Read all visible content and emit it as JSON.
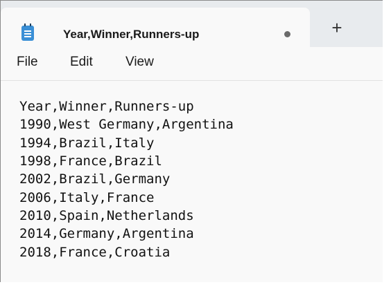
{
  "tab": {
    "title": "Year,Winner,Runners-up",
    "new_tab_label": "+"
  },
  "icons": {
    "app": "notepad-icon",
    "unsaved": "unsaved-dot-icon",
    "new_tab": "plus-icon"
  },
  "menu": {
    "file": "File",
    "edit": "Edit",
    "view": "View"
  },
  "editor": {
    "lines": [
      "Year,Winner,Runners-up",
      "1990,West Germany,Argentina",
      "1994,Brazil,Italy",
      "1998,France,Brazil",
      "2002,Brazil,Germany",
      "2006,Italy,France",
      "2010,Spain,Netherlands",
      "2014,Germany,Argentina",
      "2018,France,Croatia"
    ]
  },
  "colors": {
    "tabstrip": "#e8ebee",
    "window": "#f9f9f9",
    "accent": "#3a8fd6"
  }
}
